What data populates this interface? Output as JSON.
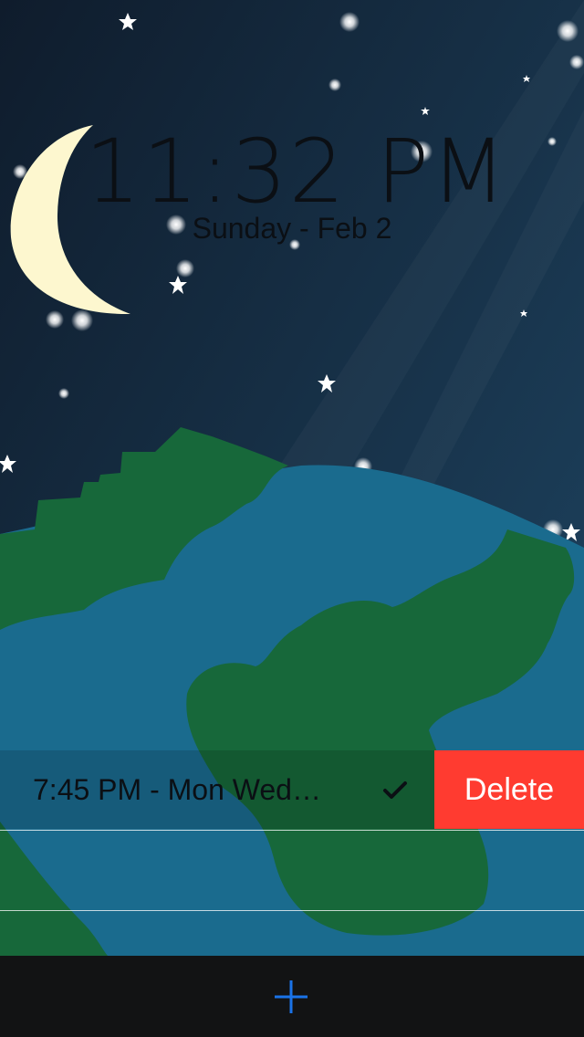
{
  "clock": {
    "time": "11:32 PM",
    "date": "Sunday - Feb 2"
  },
  "alarms": [
    {
      "label": "7:45 PM - Mon Wed…",
      "enabled": true,
      "delete_label": "Delete"
    }
  ],
  "toolbar": {
    "add_icon": "plus-icon"
  },
  "colors": {
    "sky": "#12243a",
    "moon": "#fdf7cf",
    "land": "#17683a",
    "water": "#1a6b8e",
    "delete": "#ff3b30",
    "accent": "#1a73e8",
    "toolbar": "#121314"
  }
}
